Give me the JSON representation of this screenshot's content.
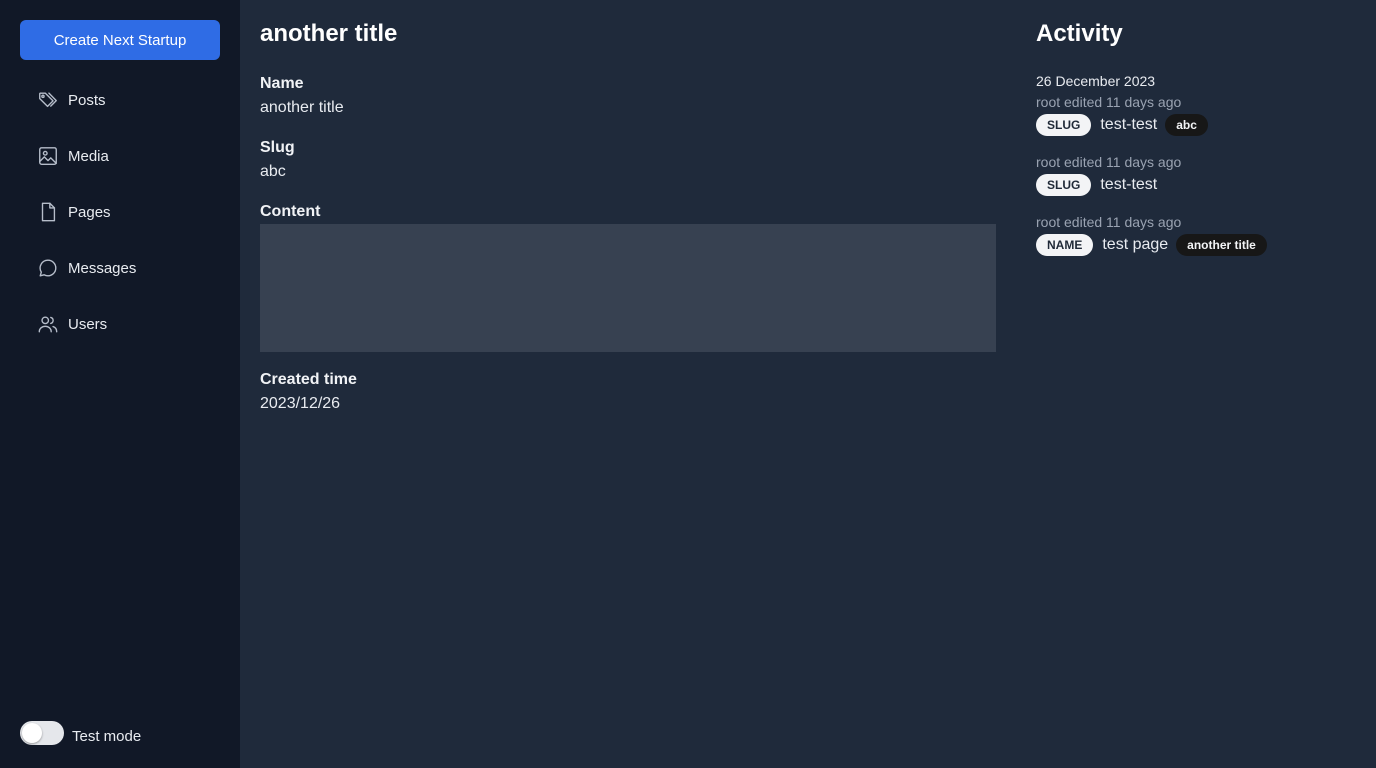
{
  "sidebar": {
    "create_button": "Create Next Startup",
    "items": [
      {
        "label": "Posts",
        "icon": "tags-icon"
      },
      {
        "label": "Media",
        "icon": "image-icon"
      },
      {
        "label": "Pages",
        "icon": "file-icon"
      },
      {
        "label": "Messages",
        "icon": "chat-bubble-icon"
      },
      {
        "label": "Users",
        "icon": "users-icon"
      }
    ],
    "test_mode": {
      "label": "Test mode",
      "enabled": false
    }
  },
  "main": {
    "title": "another title",
    "fields": {
      "name": {
        "label": "Name",
        "value": "another title"
      },
      "slug": {
        "label": "Slug",
        "value": "abc"
      },
      "content": {
        "label": "Content",
        "value": ""
      },
      "created_time": {
        "label": "Created time",
        "value": "2023/12/26"
      }
    }
  },
  "activity": {
    "title": "Activity",
    "date": "26 December 2023",
    "entries": [
      {
        "meta": "root edited 11 days ago",
        "field": "SLUG",
        "old": "test-test",
        "new": "abc"
      },
      {
        "meta": "root edited 11 days ago",
        "field": "SLUG",
        "old": "test-test",
        "new": ""
      },
      {
        "meta": "root edited 11 days ago",
        "field": "NAME",
        "old": "test page",
        "new": "another title"
      }
    ]
  },
  "colors": {
    "sidebar_bg": "#111827",
    "main_bg": "#1f2a3b",
    "accent": "#2f6ce5",
    "content_box": "#374151"
  }
}
